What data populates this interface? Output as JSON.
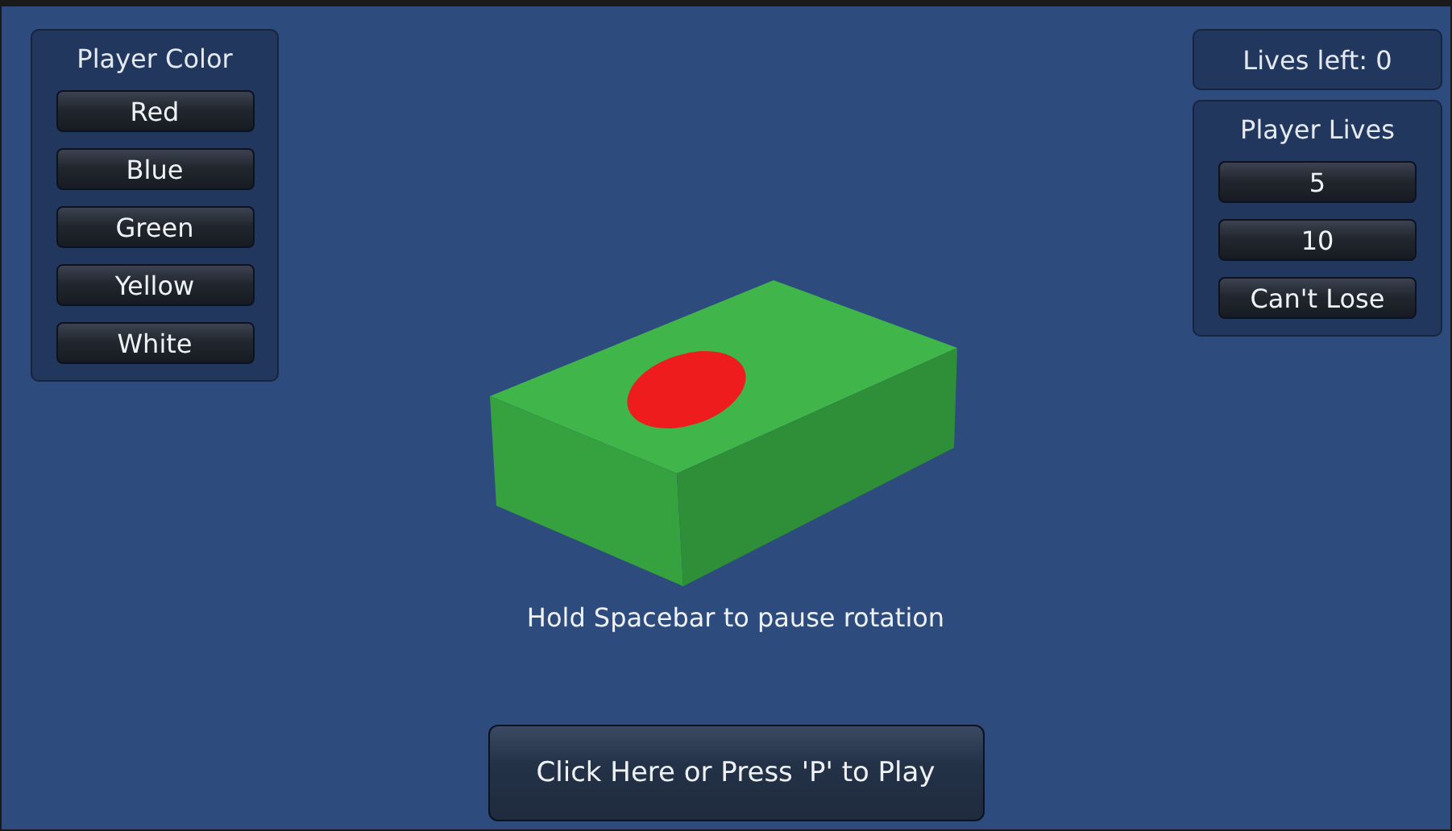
{
  "color_panel": {
    "title": "Player Color",
    "buttons": [
      "Red",
      "Blue",
      "Green",
      "Yellow",
      "White"
    ]
  },
  "lives_left": {
    "label": "Lives left: 0"
  },
  "lives_panel": {
    "title": "Player Lives",
    "buttons": [
      "5",
      "10",
      "Can't Lose"
    ]
  },
  "hint": "Hold Spacebar to pause rotation",
  "play_button": {
    "label": "Click Here or Press 'P' to Play"
  }
}
